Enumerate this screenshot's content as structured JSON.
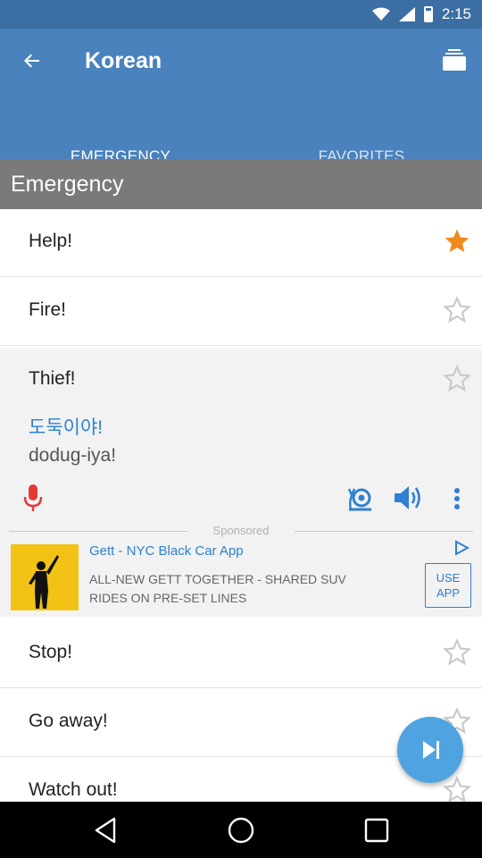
{
  "status_bar": {
    "time": "2:15",
    "icons": [
      "wifi-icon",
      "signal-icon",
      "battery-icon"
    ]
  },
  "app_bar": {
    "title": "Korean",
    "back_icon": "arrow-left-icon",
    "menu_icon": "stack-icon"
  },
  "tabs": [
    {
      "label": "EMERGENCY",
      "active": true
    },
    {
      "label": "FAVORITES",
      "active": false
    }
  ],
  "section_title": "Emergency",
  "phrases_top": [
    {
      "label": "Help!",
      "starred": true
    },
    {
      "label": "Fire!",
      "starred": false
    }
  ],
  "expanded_phrase": {
    "label": "Thief!",
    "starred": false,
    "korean": "도둑이야!",
    "romanization": "dodug-iya!",
    "icons": [
      "microphone-icon",
      "snail-icon",
      "speaker-icon",
      "more-vert-icon"
    ]
  },
  "ad": {
    "sponsored_label": "Sponsored",
    "title": "Gett - NYC Black Car App",
    "description": "ALL-NEW GETT TOGETHER - SHARED SUV RIDES ON PRE-SET LINES",
    "button_line1": "USE",
    "button_line2": "APP"
  },
  "phrases_bottom": [
    {
      "label": "Stop!",
      "starred": false
    },
    {
      "label": "Go away!",
      "starred": false
    },
    {
      "label": "Watch out!",
      "starred": false
    }
  ],
  "colors": {
    "status_bar": "#3b6ea2",
    "app_bar": "#4a82bd",
    "section": "#7a7a7a",
    "star_active": "#f08a1c",
    "star_inactive": "#c8c8c8",
    "accent_blue": "#2f7fd3",
    "mic_red": "#e53935",
    "fab": "#4fa3e0"
  },
  "nav_bar": {
    "icons": [
      "back-triangle-icon",
      "home-circle-icon",
      "recents-square-icon"
    ]
  }
}
